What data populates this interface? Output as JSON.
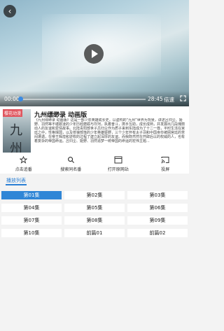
{
  "player": {
    "current_time": "00:00",
    "total_time": "28:45",
    "speed_label": "倍速",
    "progress": 0.0
  },
  "info": {
    "cover_badge": "樱花动漫",
    "cover_text": "九州",
    "title": "九州缥缈录 动画版",
    "description": "《九州缥缈录 动画版》这是一部少年英雄成长史，以虚构的“九州”世界为背景，讲述吕归尘、姬野、羽然等不堪欺凌的少年历经磨砺与坎坷，执着奋斗，携手互助，成长成熟，并发展出几段瑰丽动人的友谊和爱情故事。北陆青阳部世子吕归尘作为质子来到东陆成为了十二一尊，平时生活在宫廷之中，性格懦弱，以及苍狼部落的少年英雄姬野，三个少年怀有太子羽和中国身份被困宫廷的苦闷遭遇，在帝王辉煌和逆权的过程了建立起深厚的友谊。而我既然然在开辟后以的权威的人，也有着复杂的帝国命运。吕归尘、姬野、羽然追梦一统帝国的命运的宏伟主题..."
  },
  "actions": [
    {
      "label": "点击追番",
      "icon": "star-icon"
    },
    {
      "label": "搜索同名番",
      "icon": "search-icon"
    },
    {
      "label": "打开原网站",
      "icon": "browser-icon"
    },
    {
      "label": "投屏",
      "icon": "cast-icon"
    }
  ],
  "tabs": [
    {
      "label": "播放列表"
    }
  ],
  "episodes": [
    {
      "label": "第01集",
      "active": true
    },
    {
      "label": "第02集",
      "active": false
    },
    {
      "label": "第03集",
      "active": false
    },
    {
      "label": "第04集",
      "active": false
    },
    {
      "label": "第05集",
      "active": false
    },
    {
      "label": "第06集",
      "active": false
    },
    {
      "label": "第07集",
      "active": false
    },
    {
      "label": "第08集",
      "active": false
    },
    {
      "label": "第09集",
      "active": false
    },
    {
      "label": "第10集",
      "active": false
    },
    {
      "label": "前篇01",
      "active": false
    },
    {
      "label": "前篇02",
      "active": false
    }
  ],
  "colors": {
    "accent": "#2f86d6",
    "badge": "#e0565f"
  }
}
